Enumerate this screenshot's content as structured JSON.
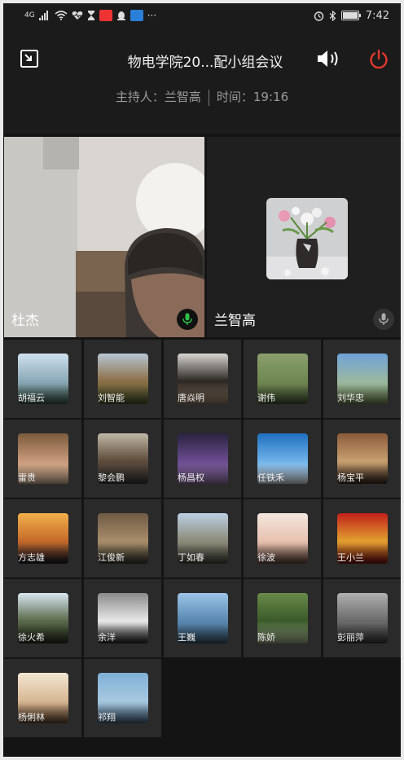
{
  "status_bar": {
    "network": "4G",
    "more": "···",
    "time": "7:42"
  },
  "header": {
    "title": "物电学院20...配小组会议",
    "host_label": "主持人：兰智高",
    "time_label": "时间：19:16"
  },
  "main_video": [
    {
      "name": "杜杰"
    },
    {
      "name": "兰智高"
    }
  ],
  "participants": [
    {
      "name": "胡福云",
      "colors": [
        "#cfe0ee",
        "#8aa9b7",
        "#3e5b4e"
      ]
    },
    {
      "name": "刘智能",
      "colors": [
        "#b8c6d4",
        "#8a6e45",
        "#4e5a2f"
      ]
    },
    {
      "name": "唐焱明",
      "colors": [
        "#d8d6d2",
        "#2b2622",
        "#a08770"
      ]
    },
    {
      "name": "谢伟",
      "colors": [
        "#8b9f6c",
        "#6e8752",
        "#4a5c36"
      ]
    },
    {
      "name": "刘华忠",
      "colors": [
        "#6fa3d8",
        "#9bb8a0",
        "#7a8d5a"
      ]
    },
    {
      "name": "雷贵",
      "colors": [
        "#7a5b3c",
        "#c99a7b",
        "#e7c6a7"
      ]
    },
    {
      "name": "黎会鹏",
      "colors": [
        "#bfb8a6",
        "#5c4a3a",
        "#3a3a3a"
      ]
    },
    {
      "name": "杨昌权",
      "colors": [
        "#2a2240",
        "#6a4c8f",
        "#9a7bb0"
      ]
    },
    {
      "name": "任铁禾",
      "colors": [
        "#1f6fc0",
        "#6fb2e8",
        "#e8eef4"
      ]
    },
    {
      "name": "杨宝平",
      "colors": [
        "#8a5a3a",
        "#c9a070",
        "#3a2a20"
      ]
    },
    {
      "name": "方志雄",
      "colors": [
        "#f3b04a",
        "#c46a2a",
        "#1a1a2a"
      ]
    },
    {
      "name": "江俊新",
      "colors": [
        "#6e5a45",
        "#a98d6a",
        "#3a3a30"
      ]
    },
    {
      "name": "丁如春",
      "colors": [
        "#bcd0e4",
        "#8c8a78",
        "#4a4a40"
      ]
    },
    {
      "name": "徐波",
      "colors": [
        "#f3e6dc",
        "#e8c2b0",
        "#6a4a40"
      ]
    },
    {
      "name": "王小兰",
      "colors": [
        "#c0201a",
        "#e2a030",
        "#7a1010"
      ]
    },
    {
      "name": "徐火希",
      "colors": [
        "#d8e6f0",
        "#5a6a4a",
        "#2a3020"
      ]
    },
    {
      "name": "余洋",
      "colors": [
        "#8a8a8a",
        "#e8e8e8",
        "#2a2a2a"
      ]
    },
    {
      "name": "王巍",
      "colors": [
        "#9cc4e8",
        "#5a88b0",
        "#3a5a70"
      ]
    },
    {
      "name": "陈娇",
      "colors": [
        "#6a8a4a",
        "#3a5a2a",
        "#a8b890"
      ]
    },
    {
      "name": "彭丽萍",
      "colors": [
        "#b0b0b0",
        "#6a6a6a",
        "#3a3a3a"
      ]
    },
    {
      "name": "杨俐林",
      "colors": [
        "#f2e6d2",
        "#d8b894",
        "#6a4a30"
      ]
    },
    {
      "name": "祁翔",
      "colors": [
        "#7fb0d8",
        "#a8c8e0",
        "#4a6a88"
      ]
    }
  ]
}
